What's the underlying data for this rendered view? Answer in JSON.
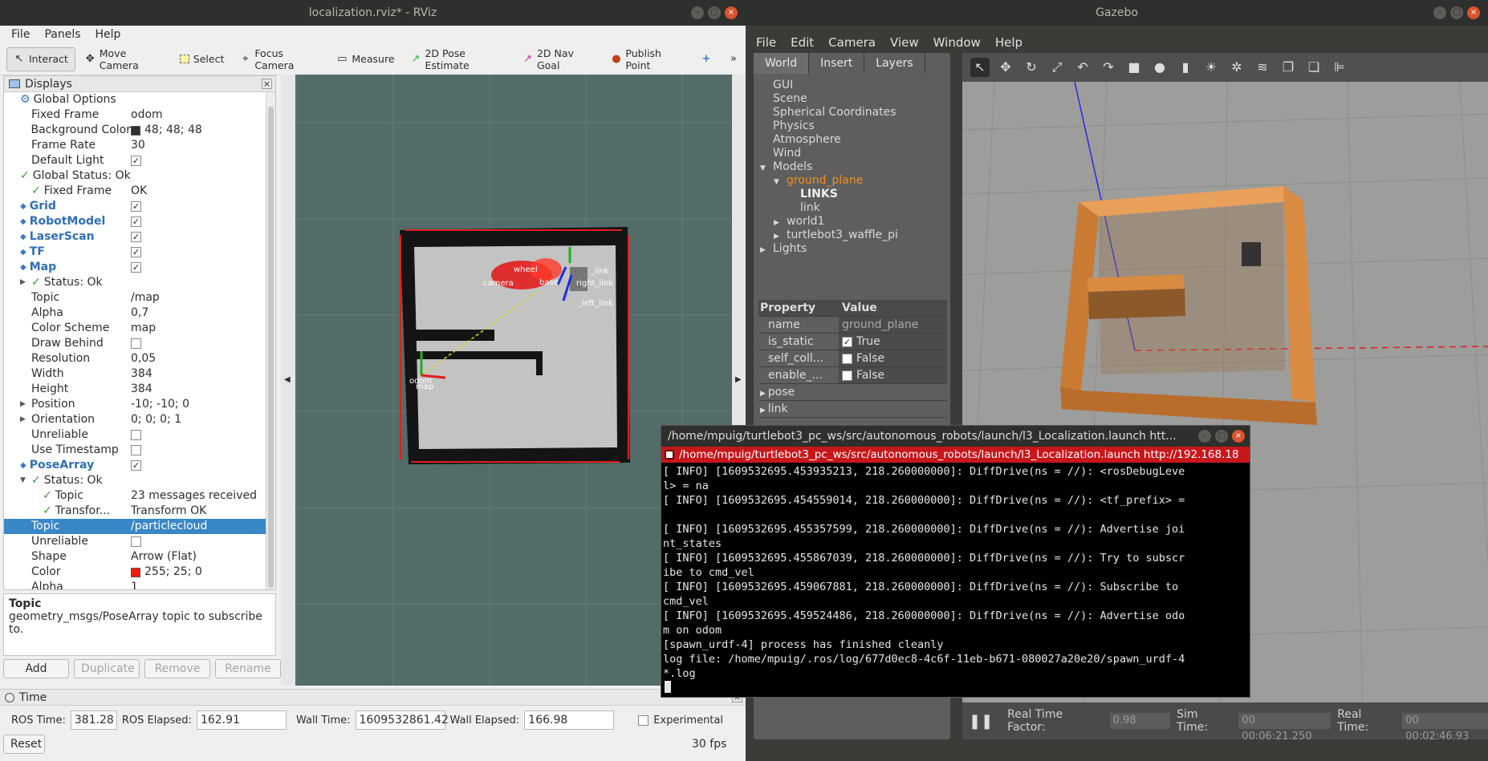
{
  "rviz": {
    "title": "localization.rviz* - RViz",
    "menu": [
      "File",
      "Panels",
      "Help"
    ],
    "tools": [
      {
        "label": "Interact",
        "icon": "cursor-icon"
      },
      {
        "label": "Move Camera",
        "icon": "move-camera-icon"
      },
      {
        "label": "Select",
        "icon": "select-icon"
      },
      {
        "label": "Focus Camera",
        "icon": "focus-icon"
      },
      {
        "label": "Measure",
        "icon": "ruler-icon"
      },
      {
        "label": "2D Pose Estimate",
        "icon": "pose-estimate-icon"
      },
      {
        "label": "2D Nav Goal",
        "icon": "nav-goal-icon"
      },
      {
        "label": "Publish Point",
        "icon": "pin-icon"
      }
    ],
    "displays_title": "Displays",
    "rows": [
      {
        "k": "Global Options",
        "v": "",
        "indent": 0,
        "icon": "gear"
      },
      {
        "k": "Fixed Frame",
        "v": "odom",
        "indent": 1
      },
      {
        "k": "Background Color",
        "v": "48; 48; 48",
        "indent": 1,
        "swatch": "#303030"
      },
      {
        "k": "Frame Rate",
        "v": "30",
        "indent": 1
      },
      {
        "k": "Default Light",
        "v": "",
        "indent": 1,
        "check": true
      },
      {
        "k": "Global Status: Ok",
        "v": "",
        "indent": 0,
        "tick": true
      },
      {
        "k": "Fixed Frame",
        "v": "OK",
        "indent": 1,
        "tick": true
      },
      {
        "k": "Grid",
        "v": "",
        "indent": 0,
        "blue": true,
        "check": true
      },
      {
        "k": "RobotModel",
        "v": "",
        "indent": 0,
        "blue": true,
        "check": true
      },
      {
        "k": "LaserScan",
        "v": "",
        "indent": 0,
        "blue": true,
        "check": true
      },
      {
        "k": "TF",
        "v": "",
        "indent": 0,
        "blue": true,
        "check": true
      },
      {
        "k": "Map",
        "v": "",
        "indent": 0,
        "blue": true,
        "check": true
      },
      {
        "k": "Status: Ok",
        "v": "",
        "indent": 1,
        "tick": true,
        "arrow": true
      },
      {
        "k": "Topic",
        "v": "/map",
        "indent": 1
      },
      {
        "k": "Alpha",
        "v": "0,7",
        "indent": 1
      },
      {
        "k": "Color Scheme",
        "v": "map",
        "indent": 1
      },
      {
        "k": "Draw Behind",
        "v": "",
        "indent": 1,
        "check": false
      },
      {
        "k": "Resolution",
        "v": "0,05",
        "indent": 1
      },
      {
        "k": "Width",
        "v": "384",
        "indent": 1
      },
      {
        "k": "Height",
        "v": "384",
        "indent": 1
      },
      {
        "k": "Position",
        "v": "-10; -10; 0",
        "indent": 1,
        "arrow": true
      },
      {
        "k": "Orientation",
        "v": "0; 0; 0; 1",
        "indent": 1,
        "arrow": true
      },
      {
        "k": "Unreliable",
        "v": "",
        "indent": 1,
        "check": false
      },
      {
        "k": "Use Timestamp",
        "v": "",
        "indent": 1,
        "check": false
      },
      {
        "k": "PoseArray",
        "v": "",
        "indent": 0,
        "blue": true,
        "check": true
      },
      {
        "k": "Status: Ok",
        "v": "",
        "indent": 1,
        "tick": true,
        "arrow": true,
        "open": true
      },
      {
        "k": "Topic",
        "v": "23 messages received",
        "indent": 2,
        "tick": true
      },
      {
        "k": "Transfor...",
        "v": "Transform OK",
        "indent": 2,
        "tick": true
      },
      {
        "k": "Topic",
        "v": "/particlecloud",
        "indent": 1,
        "sel": true
      },
      {
        "k": "Unreliable",
        "v": "",
        "indent": 1,
        "check": false
      },
      {
        "k": "Shape",
        "v": "Arrow (Flat)",
        "indent": 1
      },
      {
        "k": "Color",
        "v": "255; 25; 0",
        "indent": 1,
        "swatch": "#ff1900"
      },
      {
        "k": "Alpha",
        "v": "1",
        "indent": 1
      }
    ],
    "desc_title": "Topic",
    "desc_text": "geometry_msgs/PoseArray topic to subscribe to.",
    "buttons": [
      "Add",
      "Duplicate",
      "Remove",
      "Rename"
    ],
    "time": {
      "title": "Time",
      "ros_time_label": "ROS Time:",
      "ros_time": "381.28",
      "ros_elapsed_label": "ROS Elapsed:",
      "ros_elapsed": "162.91",
      "wall_time_label": "Wall Time:",
      "wall_time": "1609532861.42",
      "wall_elapsed_label": "Wall Elapsed:",
      "wall_elapsed": "166.98",
      "experimental": "Experimental",
      "reset": "Reset",
      "fps": "30 fps"
    },
    "viewport_labels": [
      "odom",
      "map",
      "wheel",
      "camera",
      "base",
      "right_link",
      "_left_link",
      "_link"
    ]
  },
  "gazebo": {
    "title": "Gazebo",
    "menu": [
      "File",
      "Edit",
      "Camera",
      "View",
      "Window",
      "Help"
    ],
    "tabs": [
      "World",
      "Insert",
      "Layers"
    ],
    "tree": [
      {
        "t": "GUI",
        "i": 0
      },
      {
        "t": "Scene",
        "i": 0
      },
      {
        "t": "Spherical Coordinates",
        "i": 0
      },
      {
        "t": "Physics",
        "i": 0
      },
      {
        "t": "Atmosphere",
        "i": 0
      },
      {
        "t": "Wind",
        "i": 0
      },
      {
        "t": "Models",
        "i": 0,
        "arrow": "open"
      },
      {
        "t": "ground_plane",
        "i": 1,
        "arrow": "open",
        "orange": true
      },
      {
        "t": "LINKS",
        "i": 2,
        "bold": true
      },
      {
        "t": "link",
        "i": 2
      },
      {
        "t": "world1",
        "i": 1,
        "arrow": "closed"
      },
      {
        "t": "turtlebot3_waffle_pi",
        "i": 1,
        "arrow": "closed"
      },
      {
        "t": "Lights",
        "i": 0,
        "arrow": "closed"
      }
    ],
    "prop_head": [
      "Property",
      "Value"
    ],
    "props": [
      {
        "k": "name",
        "v": "ground_plane"
      },
      {
        "k": "is_static",
        "v": "True",
        "check": true
      },
      {
        "k": "self_coll...",
        "v": "False",
        "check": false
      },
      {
        "k": "enable_...",
        "v": "False",
        "check": false
      },
      {
        "k": "pose",
        "v": "",
        "arrow": true
      },
      {
        "k": "link",
        "v": "",
        "arrow": true
      }
    ],
    "bottom": {
      "rtf_label": "Real Time Factor:",
      "rtf": "0.98",
      "sim_label": "Sim Time:",
      "sim": "00 00:06:21.250",
      "real_label": "Real Time:",
      "real": "00 00:02:46.93"
    }
  },
  "terminal": {
    "title": "/home/mpuig/turtlebot3_pc_ws/src/autonomous_robots/launch/l3_Localization.launch htt...",
    "tab": "/home/mpuig/turtlebot3_pc_ws/src/autonomous_robots/launch/l3_Localization.launch http://192.168.18",
    "lines": [
      "[ INFO] [1609532695.453935213, 218.260000000]: DiffDrive(ns = //): <rosDebugLeve",
      "l> = na",
      "[ INFO] [1609532695.454559014, 218.260000000]: DiffDrive(ns = //): <tf_prefix> =",
      "",
      "[ INFO] [1609532695.455357599, 218.260000000]: DiffDrive(ns = //): Advertise joi",
      "nt_states",
      "[ INFO] [1609532695.455867039, 218.260000000]: DiffDrive(ns = //): Try to subscr",
      "ibe to cmd_vel",
      "[ INFO] [1609532695.459067881, 218.260000000]: DiffDrive(ns = //): Subscribe to",
      "cmd_vel",
      "[ INFO] [1609532695.459524486, 218.260000000]: DiffDrive(ns = //): Advertise odo",
      "m on odom",
      "[spawn_urdf-4] process has finished cleanly",
      "log file: /home/mpuig/.ros/log/677d0ec8-4c6f-11eb-b671-080027a20e20/spawn_urdf-4",
      "*.log"
    ]
  }
}
